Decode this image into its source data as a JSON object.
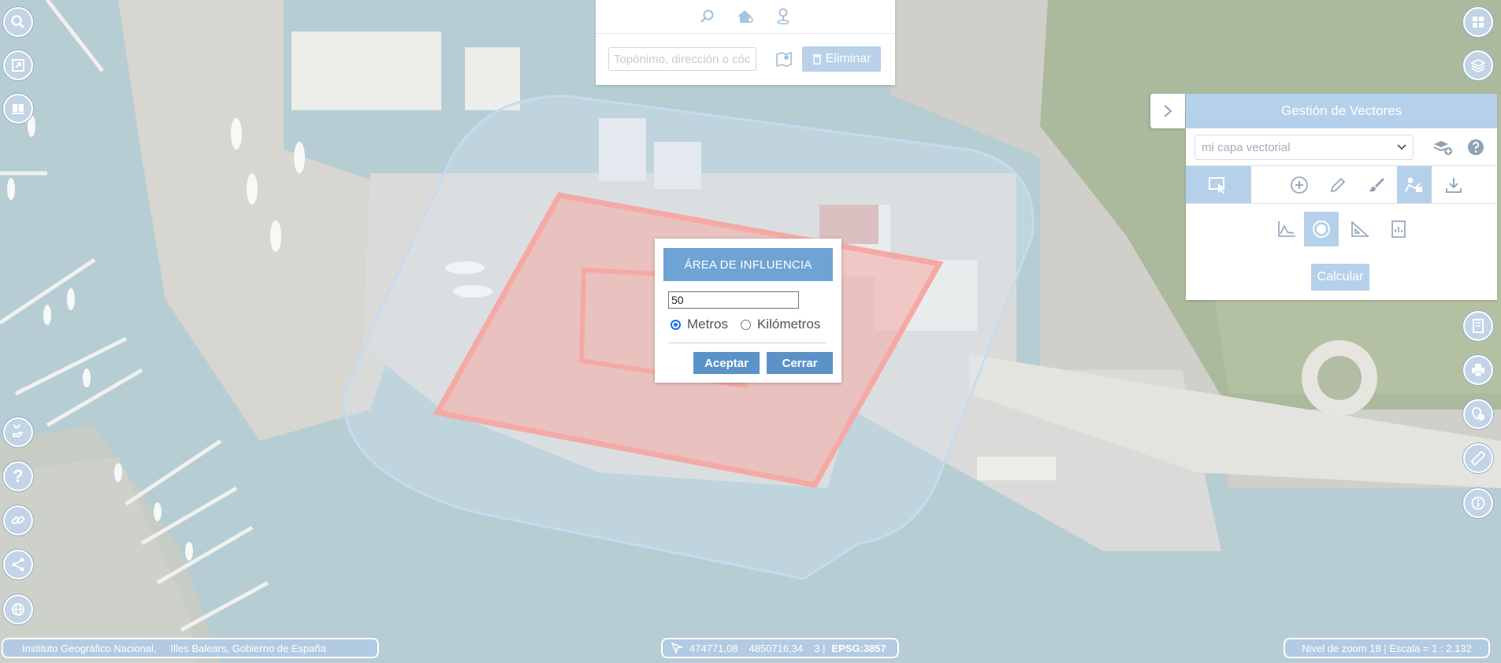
{
  "search": {
    "placeholder": "Topónimo, dirección o cóc",
    "delete_label": "Eliminar",
    "icons": [
      "zoom-search-icon",
      "home-search-icon",
      "location-pin-icon",
      "map-search-icon"
    ]
  },
  "left_toolbar": {
    "top_icons": [
      "zoom-icon",
      "extent-icon",
      "book-icon"
    ],
    "bottom_icons": [
      "hand-icon",
      "help-icon",
      "link-icon",
      "share-icon",
      "globe-icon"
    ],
    "help_glyph": "?"
  },
  "right_toolbar": {
    "top_icons": [
      "grid-icon",
      "layers-icon"
    ],
    "bottom_icons": [
      "map-book-icon",
      "print-icon",
      "location-info-icon",
      "ruler-icon",
      "info-icon"
    ]
  },
  "vector_panel": {
    "title": "Gestión de Vectores",
    "layer_select_value": "mi capa vectorial",
    "tools": [
      "select-tool",
      "add-tool",
      "edit-tool",
      "style-tool",
      "analysis-tool",
      "download-tool"
    ],
    "active_tool": "analysis-tool",
    "subtools": [
      "profile-tool",
      "buffer-tool",
      "measure-tool",
      "report-tool"
    ],
    "active_subtool": "buffer-tool",
    "calculate_label": "Calcular"
  },
  "influence_dialog": {
    "title": "ÁREA DE INFLUENCIA",
    "distance_value": "50",
    "unit_meters": "Metros",
    "unit_kilometers": "Kilómetros",
    "selected_unit": "Metros",
    "accept_label": "Aceptar",
    "close_label": "Cerrar"
  },
  "attribution": {
    "source1": "Instituto Geográfico Nacional,",
    "source2": "Illes Balears, Gobierno de España"
  },
  "coordinates": {
    "x": "474771,08",
    "y": "4850716,34",
    "zone": "3 |",
    "crs": "EPSG:3857"
  },
  "scale_info": {
    "text": "Nivel de zoom 18 | Escala = 1 : 2.132"
  },
  "colors": {
    "accent": "#6fa3d3",
    "panel_header": "#b5d0ea",
    "polygon_fill": "#f07c74",
    "buffer_stroke": "#a8c8e8"
  }
}
